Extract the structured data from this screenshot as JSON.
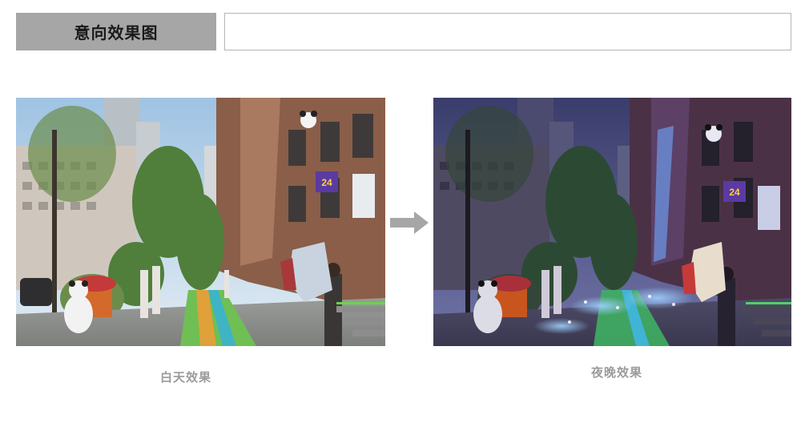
{
  "header": {
    "title": "意向效果图",
    "subtitle_value": ""
  },
  "images": {
    "day": {
      "caption": "白天效果",
      "sign_number": "24"
    },
    "night": {
      "caption": "夜晚效果",
      "sign_number": "24"
    }
  },
  "icons": {
    "arrow": "right-arrow-icon"
  },
  "colors": {
    "title_bg": "#a6a6a6",
    "caption": "#9b9b9b",
    "arrow": "#a6a6a6"
  }
}
